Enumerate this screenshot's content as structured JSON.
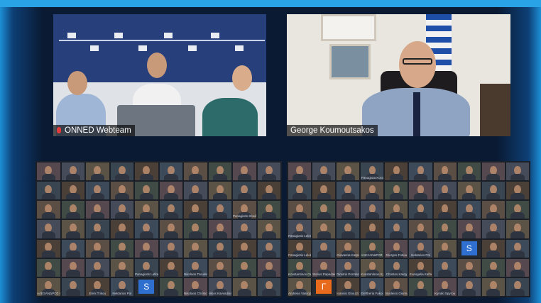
{
  "speakers": {
    "left": {
      "name": "ONNED Webteam",
      "muted": true
    },
    "right": {
      "name": "George Koumoutsakos"
    }
  },
  "gallery_left": {
    "rows": 7,
    "cols": 10,
    "names": [
      {
        "row": 3,
        "col": 9,
        "text": "Panagiotis Sfoulis"
      },
      {
        "row": 6,
        "col": 5,
        "text": "Panagiotis Lefkas"
      },
      {
        "row": 6,
        "col": 7,
        "text": "Nikolaos Tsoukis"
      },
      {
        "row": 7,
        "col": 1,
        "text": "ΑΛΕΞΑΝΔΡΟΣ ΕΡ"
      },
      {
        "row": 7,
        "col": 3,
        "text": "Eleni Trikou"
      },
      {
        "row": 7,
        "col": 4,
        "text": "Nektarios Pol"
      },
      {
        "row": 7,
        "col": 7,
        "text": "Nikolaos Christod"
      },
      {
        "row": 7,
        "col": 8,
        "text": "Nikos Kavvadias"
      }
    ],
    "avatar_tiles": [
      {
        "row": 7,
        "col": 5,
        "letter": "S",
        "color": "#2f6fd0"
      }
    ]
  },
  "gallery_right": {
    "rows": 7,
    "cols": 10,
    "names": [
      {
        "row": 1,
        "col": 4,
        "text": "Panagiota Kora"
      },
      {
        "row": 4,
        "col": 1,
        "text": "Panagiotis Lelentis"
      },
      {
        "row": 5,
        "col": 1,
        "text": "Panagiotis Lelokas"
      },
      {
        "row": 5,
        "col": 3,
        "text": "Giovanna Karpa"
      },
      {
        "row": 5,
        "col": 4,
        "text": "ΑΛΕΞΑΝΔΡΟΣ Π"
      },
      {
        "row": 5,
        "col": 5,
        "text": "Giorgos Fotiou"
      },
      {
        "row": 5,
        "col": 6,
        "text": "Nektarios Pol"
      },
      {
        "row": 6,
        "col": 1,
        "text": "Konstantinos Ger"
      },
      {
        "row": 6,
        "col": 2,
        "text": "Stelios Papadakis"
      },
      {
        "row": 6,
        "col": 3,
        "text": "Dimitris Pontikos"
      },
      {
        "row": 6,
        "col": 4,
        "text": "Konstantinos Kyr"
      },
      {
        "row": 6,
        "col": 5,
        "text": "Christos Kalog"
      },
      {
        "row": 6,
        "col": 6,
        "text": "Evangelia Kalfa"
      },
      {
        "row": 7,
        "col": 1,
        "text": "Andreas Vasilopoulos"
      },
      {
        "row": 7,
        "col": 3,
        "text": "Ioannis Gkoutzos"
      },
      {
        "row": 7,
        "col": 4,
        "text": "Eleftheria Fakou"
      },
      {
        "row": 7,
        "col": 5,
        "text": "Vasileios Giannakis"
      },
      {
        "row": 7,
        "col": 7,
        "text": "Kyriaki Spyrou"
      }
    ],
    "avatar_tiles": [
      {
        "row": 5,
        "col": 8,
        "letter": "S",
        "color": "#2f6fd0"
      },
      {
        "row": 7,
        "col": 2,
        "letter": "Γ",
        "color": "#e86a1c"
      }
    ]
  },
  "colors": {
    "background": "#0a1a33",
    "accent_frame": "#1c8fd6",
    "muted_mic": "#e23b3b"
  }
}
